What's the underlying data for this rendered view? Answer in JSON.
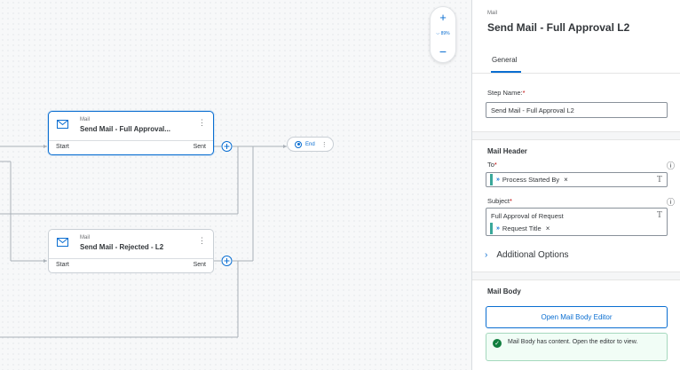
{
  "canvas": {
    "zoom": {
      "plus_label": "+",
      "level": "89%",
      "minus_label": "−"
    },
    "nodes": [
      {
        "type": "Mail",
        "title": "Send Mail - Full Approval...",
        "start": "Start",
        "sent": "Sent"
      },
      {
        "type": "Mail",
        "title": "Send Mail - Rejected - L2",
        "start": "Start",
        "sent": "Sent"
      }
    ],
    "end": {
      "label": "End"
    }
  },
  "panel": {
    "type_label": "Mail",
    "title": "Send Mail - Full Approval L2",
    "tabs": [
      "General"
    ],
    "step_name": {
      "label": "Step Name:",
      "required_mark": "*",
      "value": "Send Mail - Full Approval L2"
    },
    "mail_header": {
      "heading": "Mail Header",
      "to": {
        "label": "To",
        "required_mark": "*",
        "token": "Process Started By"
      },
      "subject": {
        "label": "Subject",
        "required_mark": "*",
        "text": "Full Approval of Request",
        "token": "Request Title"
      }
    },
    "additional_options": "Additional Options",
    "mail_body": {
      "heading": "Mail Body",
      "open_button": "Open Mail Body Editor",
      "message": "Mail Body has content. Open the editor to view."
    }
  },
  "colors": {
    "accent": "#0a6ed1",
    "token_bar": "#3aa89a",
    "success": "#107e3e",
    "required": "#bb0000"
  }
}
